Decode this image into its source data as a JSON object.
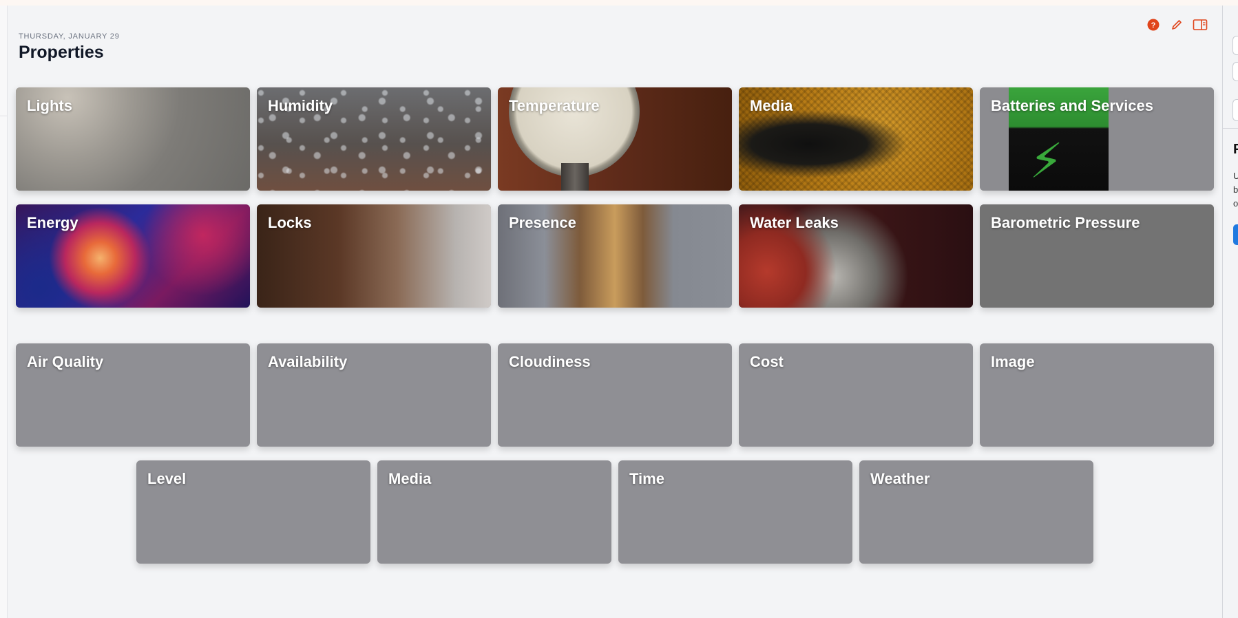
{
  "header": {
    "date": "THURSDAY, JANUARY 29",
    "title": "Properties"
  },
  "toolbar": {
    "icons": [
      "help-icon",
      "edit-pencil-icon",
      "sidebar-toggle-icon"
    ],
    "accent": "#e0441b"
  },
  "image_tiles_row1": [
    {
      "label": "Lights"
    },
    {
      "label": "Humidity"
    },
    {
      "label": "Temperature"
    },
    {
      "label": "Media"
    },
    {
      "label": "Batteries and Services"
    }
  ],
  "image_tiles_row2": [
    {
      "label": "Energy"
    },
    {
      "label": "Locks"
    },
    {
      "label": "Presence"
    },
    {
      "label": "Water Leaks"
    },
    {
      "label": "Barometric Pressure"
    }
  ],
  "plain_tiles_row1": [
    {
      "label": "Air Quality"
    },
    {
      "label": "Availability"
    },
    {
      "label": "Cloudiness"
    },
    {
      "label": "Cost"
    },
    {
      "label": "Image"
    }
  ],
  "plain_tiles_row2": [
    {
      "label": "Level"
    },
    {
      "label": "Media"
    },
    {
      "label": "Time"
    },
    {
      "label": "Weather"
    }
  ],
  "sidepanel": {
    "heading": "P",
    "lines": [
      "U",
      "b",
      "o"
    ]
  },
  "colors": {
    "tile_gray": "#8f8f94",
    "background": "#f3f4f6",
    "sidepanel_button": "#1f7ae0"
  }
}
